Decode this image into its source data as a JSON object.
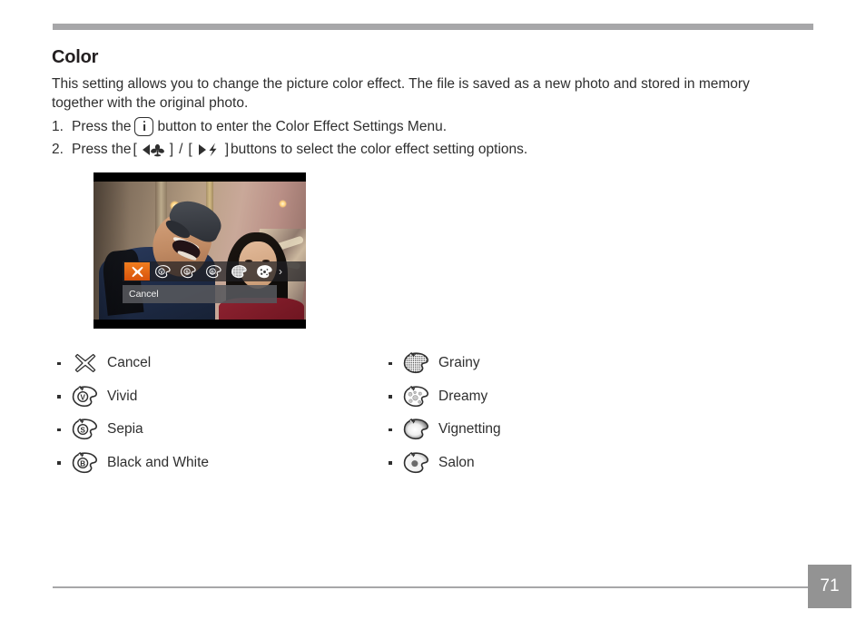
{
  "document": {
    "page_number": "71",
    "heading": "Color",
    "intro": "This setting allows you to change the picture color effect. The file is saved as a new photo and stored in memory together with the original photo."
  },
  "steps": [
    {
      "number": "1.",
      "text_before": "Press the",
      "icon": "info-button-icon",
      "text_after": "button to enter the Color Effect Settings Menu."
    },
    {
      "number": "2.",
      "text_before": "Press the",
      "bracket_open": "[",
      "icon_left": "left-arrow-macro-icon",
      "bracket_close": "]",
      "separator": "/",
      "bracket_open_2": "[",
      "icon_right": "right-arrow-flash-icon",
      "bracket_close_2": "]",
      "text_after": "buttons to select the color effect setting options."
    }
  ],
  "camera_screen": {
    "osd_label": "Cancel",
    "selected_index": 0,
    "more_arrow": "›",
    "highlight_color": "#e4640f",
    "icons": [
      {
        "name": "cancel-effect-icon",
        "letter": ""
      },
      {
        "name": "vivid-effect-icon",
        "letter": "V"
      },
      {
        "name": "sepia-effect-icon",
        "letter": "S"
      },
      {
        "name": "black-and-white-effect-icon",
        "letter": "B"
      },
      {
        "name": "grainy-effect-icon",
        "letter": ""
      },
      {
        "name": "dreamy-effect-icon",
        "letter": ""
      }
    ]
  },
  "legend": {
    "left": [
      {
        "icon": "cancel-effect-icon",
        "label": "Cancel"
      },
      {
        "icon": "vivid-effect-icon",
        "label": "Vivid"
      },
      {
        "icon": "sepia-effect-icon",
        "label": "Sepia"
      },
      {
        "icon": "black-and-white-effect-icon",
        "label": "Black and White"
      }
    ],
    "right": [
      {
        "icon": "grainy-effect-icon",
        "label": "Grainy"
      },
      {
        "icon": "dreamy-effect-icon",
        "label": "Dreamy"
      },
      {
        "icon": "vignetting-effect-icon",
        "label": "Vignetting"
      },
      {
        "icon": "salon-effect-icon",
        "label": "Salon"
      }
    ]
  },
  "colors": {
    "rule": "#a7a7a9",
    "page_badge": "#939393",
    "text": "#2f2f2f"
  }
}
